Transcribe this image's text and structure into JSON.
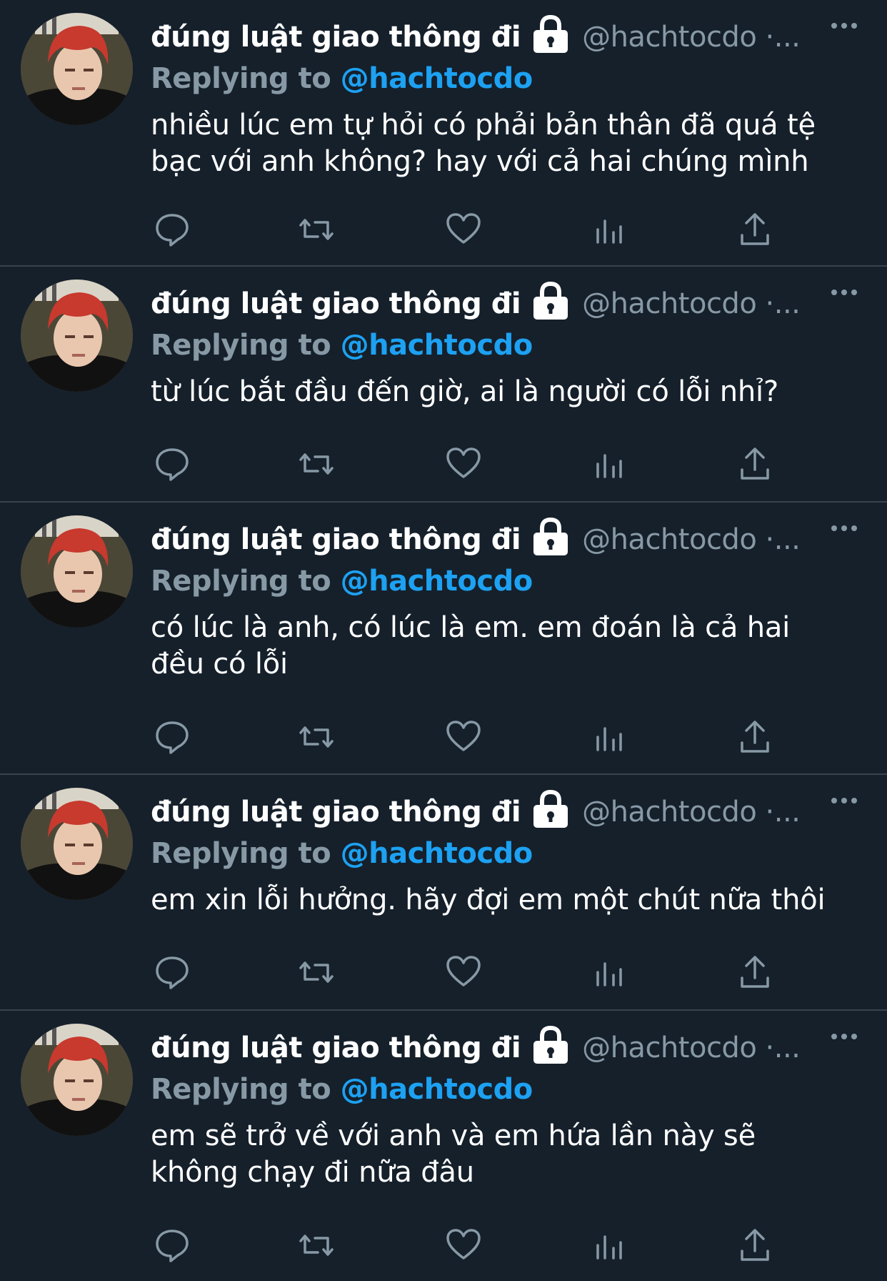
{
  "tweets": [
    {
      "name": "đúng luật giao thông đi",
      "handle": "@hachtocdo ·...",
      "replying_prefix": "Replying to ",
      "replying_handle": "@hachtocdo",
      "text": "nhiều lúc em tự hỏi có phải bản thân đã quá tệ\nbạc với anh không? hay với cả hai chúng mình"
    },
    {
      "name": "đúng luật giao thông đi",
      "handle": "@hachtocdo ·...",
      "replying_prefix": "Replying to ",
      "replying_handle": "@hachtocdo",
      "text": "từ lúc bắt đầu đến giờ, ai là người có lỗi nhỉ?"
    },
    {
      "name": "đúng luật giao thông đi",
      "handle": "@hachtocdo ·...",
      "replying_prefix": "Replying to ",
      "replying_handle": "@hachtocdo",
      "text": "có lúc là anh, có lúc là em. em đoán là cả hai\nđều có lỗi"
    },
    {
      "name": "đúng luật giao thông đi",
      "handle": "@hachtocdo ·...",
      "replying_prefix": "Replying to ",
      "replying_handle": "@hachtocdo",
      "text": "em xin lỗi hưởng. hãy đợi em một chút nữa thôi"
    },
    {
      "name": "đúng luật giao thông đi",
      "handle": "@hachtocdo ·...",
      "replying_prefix": "Replying to ",
      "replying_handle": "@hachtocdo",
      "text": "em sẽ trở về với anh và em hứa lần này sẽ\nkhông chạy đi nữa đâu"
    }
  ],
  "icons": {
    "lock": "lock-icon",
    "more": "more-icon",
    "reply": "reply-icon",
    "retweet": "retweet-icon",
    "like": "heart-icon",
    "analytics": "analytics-icon",
    "share": "share-icon"
  },
  "colors": {
    "background": "#15202b",
    "divider": "#38444d",
    "secondary_text": "#8899a6",
    "link": "#1da1f2"
  }
}
